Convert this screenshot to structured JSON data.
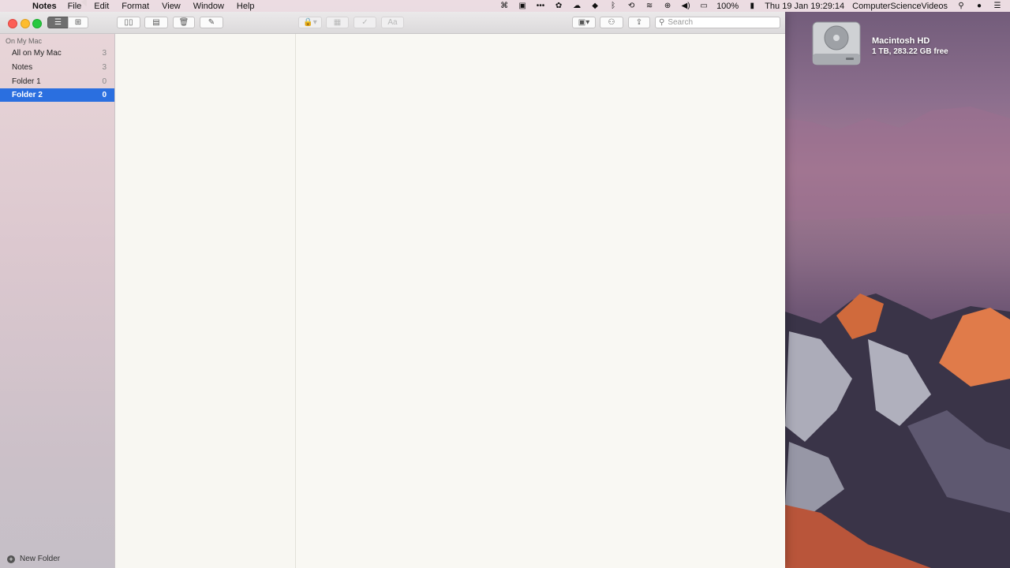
{
  "menubar": {
    "app_name": "Notes",
    "menus": [
      "File",
      "Edit",
      "Format",
      "View",
      "Window",
      "Help"
    ],
    "battery": "100%",
    "datetime": "Thu 19 Jan  19:29:14",
    "user": "ComputerScienceVideos"
  },
  "desktop": {
    "drive_name": "Macintosh HD",
    "drive_info": "1 TB, 283.22 GB free"
  },
  "toolbar": {
    "search_placeholder": "Search",
    "format_label": "Aa"
  },
  "sidebar": {
    "section_title": "On My Mac",
    "folders": [
      {
        "name": "All on My Mac",
        "count": "3"
      },
      {
        "name": "Notes",
        "count": "3"
      },
      {
        "name": "Folder 1",
        "count": "0"
      },
      {
        "name": "Folder 2",
        "count": "0",
        "selected": true
      }
    ],
    "new_folder_label": "New Folder"
  },
  "colors": {
    "selection": "#2a6fe0",
    "close": "#fc5f57",
    "minimize": "#fdbc2e",
    "zoom": "#28c840"
  }
}
